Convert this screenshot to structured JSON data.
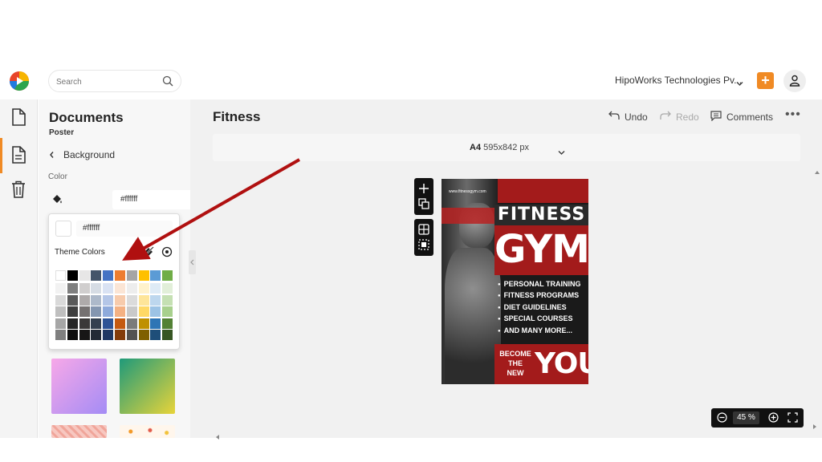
{
  "topbar": {
    "search_placeholder": "Search",
    "org_name": "HipoWorks Technologies Pv...",
    "add_label": "+"
  },
  "rail": {
    "items": [
      "documents-icon",
      "document-active-icon",
      "trash-icon"
    ]
  },
  "panel": {
    "title": "Documents",
    "subtitle": "Poster",
    "back_label": "Background",
    "color_label": "Color",
    "hex_value": "#ffffff"
  },
  "popover": {
    "hex_value": "#ffffff",
    "theme_label": "Theme Colors",
    "theme_colors": [
      [
        "#ffffff",
        "#f2f2f2",
        "#d9d9d9",
        "#bfbfbf",
        "#a6a6a6",
        "#7f7f7f"
      ],
      [
        "#000000",
        "#7f7f7f",
        "#595959",
        "#3f3f3f",
        "#262626",
        "#0d0d0d"
      ],
      [
        "#e7e6e6",
        "#d0cece",
        "#aeaaaa",
        "#757171",
        "#3a3838",
        "#171616"
      ],
      [
        "#44546a",
        "#d6dce4",
        "#adb9ca",
        "#8496b0",
        "#333f4f",
        "#222a35"
      ],
      [
        "#4472c4",
        "#d9e2f3",
        "#b4c6e7",
        "#8eaadb",
        "#2f5496",
        "#1f3864"
      ],
      [
        "#ed7d31",
        "#fbe5d5",
        "#f7cbac",
        "#f4b183",
        "#c55a11",
        "#833c0b"
      ],
      [
        "#a5a5a5",
        "#ededed",
        "#dbdbdb",
        "#c9c9c9",
        "#7b7b7b",
        "#525252"
      ],
      [
        "#ffc000",
        "#fff2cc",
        "#fee599",
        "#ffd965",
        "#bf9000",
        "#7f6000"
      ],
      [
        "#5b9bd5",
        "#deebf6",
        "#bdd7ee",
        "#9cc3e5",
        "#2e75b5",
        "#1e4e79"
      ],
      [
        "#70ad47",
        "#e2efd9",
        "#c5e0b3",
        "#a8d08d",
        "#538135",
        "#375623"
      ]
    ]
  },
  "thumbs": [
    {
      "name": "gradient-pink-purple",
      "from": "#f7a8e8",
      "to": "#a48cf5"
    },
    {
      "name": "gradient-green-yellow",
      "from": "#1f9a7a",
      "to": "#e8d43a"
    }
  ],
  "canvas": {
    "doc_title": "Fitness",
    "undo_label": "Undo",
    "redo_label": "Redo",
    "comments_label": "Comments",
    "more_label": "•••",
    "page_size_name": "A4",
    "page_size_dims": "595x842 px",
    "zoom_value": "45",
    "zoom_unit": "%"
  },
  "poster": {
    "url": "www.fitnessgym.com",
    "title_1": "FITNESS",
    "title_2": "GYM",
    "items": [
      "PERSONAL TRAINING",
      "FITNESS PROGRAMS",
      "DIET GUIDELINES",
      "SPECIAL COURSES",
      "AND MANY MORE..."
    ],
    "become_1": "BECOME",
    "become_2": "THE",
    "become_3": "NEW",
    "you": "YOU"
  },
  "colors": {
    "accent": "#f08a24",
    "poster_red": "#a31b1b",
    "annotation_red": "#b01010"
  }
}
